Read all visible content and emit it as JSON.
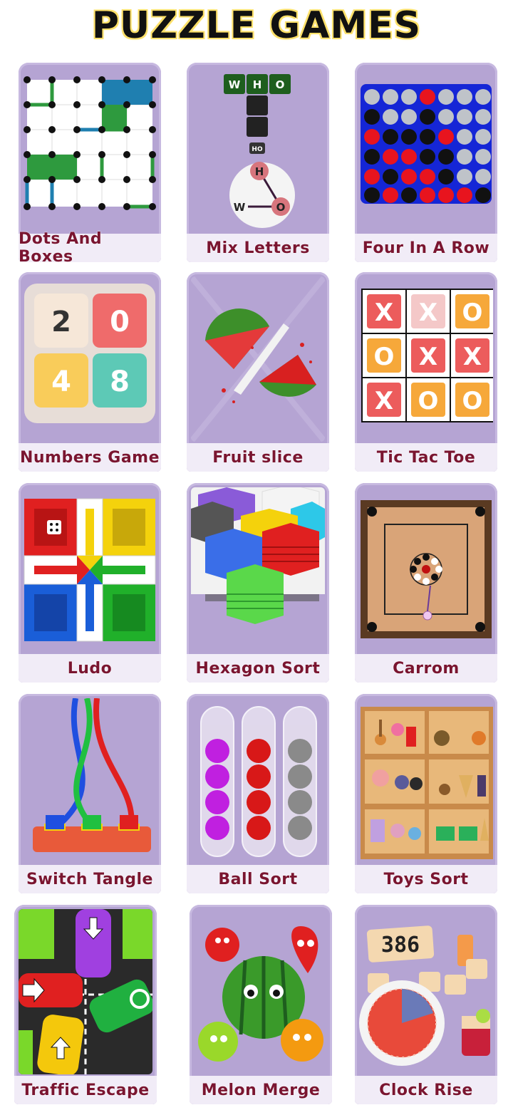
{
  "header": {
    "title": "PUZZLE GAMES"
  },
  "games": [
    {
      "label": "Dots And Boxes",
      "icon": "dots-grid-icon"
    },
    {
      "label": "Mix Letters",
      "icon": "letter-wheel-icon",
      "word_tiles": [
        "W",
        "H",
        "O"
      ],
      "hint": "HO",
      "wheel_letters": [
        "H",
        "W",
        "O"
      ]
    },
    {
      "label": "Four In A Row",
      "icon": "connect-four-icon"
    },
    {
      "label": "Numbers Game",
      "icon": "number-tiles-icon",
      "tiles": [
        "2",
        "0",
        "4",
        "8"
      ]
    },
    {
      "label": "Fruit slice",
      "icon": "watermelon-slice-icon"
    },
    {
      "label": "Tic Tac Toe",
      "icon": "tic-tac-toe-icon",
      "cells": [
        "X",
        "X",
        "O",
        "O",
        "X",
        "X",
        "X",
        "O",
        "O"
      ]
    },
    {
      "label": "Ludo",
      "icon": "ludo-board-icon"
    },
    {
      "label": "Hexagon Sort",
      "icon": "hexagon-stack-icon"
    },
    {
      "label": "Carrom",
      "icon": "carrom-board-icon"
    },
    {
      "label": "Switch Tangle",
      "icon": "tangled-cables-icon"
    },
    {
      "label": "Ball Sort",
      "icon": "ball-tubes-icon"
    },
    {
      "label": "Toys Sort",
      "icon": "toy-shelf-icon"
    },
    {
      "label": "Traffic Escape",
      "icon": "traffic-cars-icon"
    },
    {
      "label": "Melon Merge",
      "icon": "fruit-faces-icon"
    },
    {
      "label": "Clock Rise",
      "icon": "clock-tiles-icon",
      "counter": "386"
    }
  ]
}
